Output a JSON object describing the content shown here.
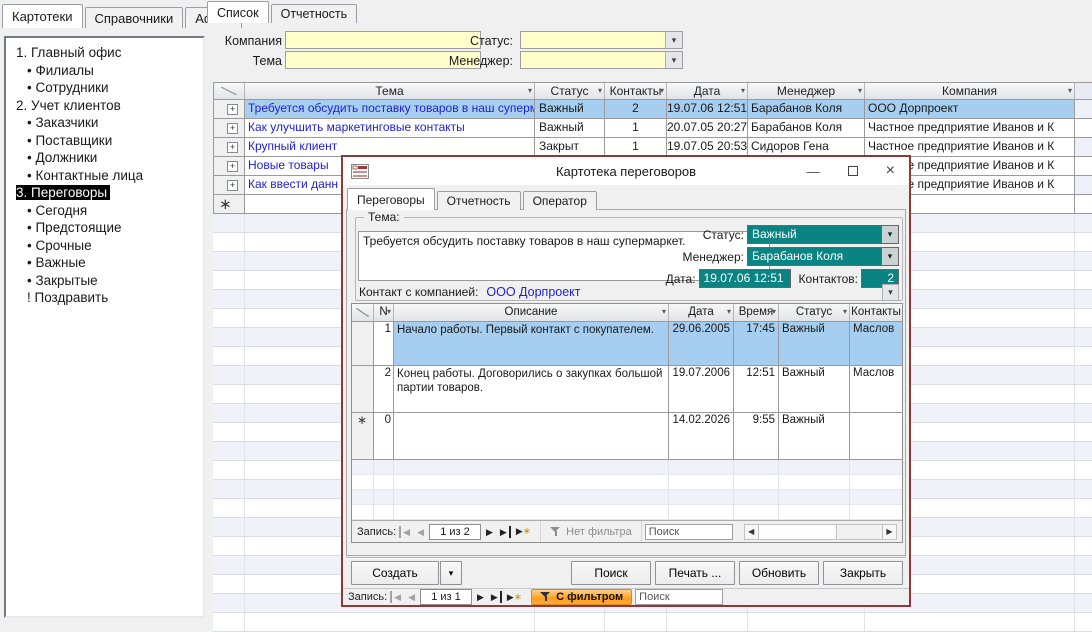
{
  "app": {
    "window_tabs": [
      {
        "label": "Картотеки"
      },
      {
        "label": "Справочники"
      },
      {
        "label": "Admin"
      }
    ],
    "sidebar": {
      "items": [
        {
          "label": "1. Главный офис"
        },
        {
          "label": "• Филиалы"
        },
        {
          "label": "• Сотрудники"
        },
        {
          "label": "2. Учет клиентов"
        },
        {
          "label": "• Заказчики"
        },
        {
          "label": "• Поставщики"
        },
        {
          "label": "• Должники"
        },
        {
          "label": "• Контактные лица"
        },
        {
          "label": "3. Переговоры",
          "selected": true
        },
        {
          "label": "• Сегодня"
        },
        {
          "label": "• Предстоящие"
        },
        {
          "label": "• Срочные"
        },
        {
          "label": "• Важные"
        },
        {
          "label": "• Закрытые"
        },
        {
          "label": "! Поздравить"
        }
      ]
    }
  },
  "main": {
    "tabs": [
      {
        "label": "Список"
      },
      {
        "label": "Отчетность"
      }
    ],
    "filters": {
      "company_label": "Компания",
      "theme_label": "Тема",
      "status_label": "Статус:",
      "manager_label": "Менеджер:",
      "company_value": "",
      "theme_value": "",
      "status_value": "",
      "manager_value": ""
    },
    "table": {
      "columns": [
        "Тема",
        "Статус",
        "Контакты",
        "Дата",
        "Менеджер",
        "Компания"
      ],
      "rows": [
        {
          "theme": "Требуется обсудить поставку товаров в наш супермаркет.",
          "status": "Важный",
          "contacts": "2",
          "date": "19.07.06 12:51",
          "manager": "Барабанов Коля",
          "company": "ООО Дорпроект"
        },
        {
          "theme": "Как улучшить маркетинговые контакты",
          "status": "Важный",
          "contacts": "1",
          "date": "20.07.05 20:27",
          "manager": "Барабанов Коля",
          "company": "Частное предприятие Иванов и К"
        },
        {
          "theme": "Крупный клиент",
          "status": "Закрыт",
          "contacts": "1",
          "date": "19.07.05 20:53",
          "manager": "Сидоров Гена",
          "company": "Частное предприятие Иванов и К"
        },
        {
          "theme": "Новые товары",
          "status": "",
          "contacts": "",
          "date": "",
          "manager": "",
          "company": "Частное предприятие Иванов и К"
        },
        {
          "theme": "Как ввести данн",
          "status": "",
          "contacts": "",
          "date": "",
          "manager": "",
          "company": "Частное предприятие Иванов и К"
        }
      ]
    }
  },
  "dialog": {
    "title": "Картотека переговоров",
    "window_icons": {
      "minimize": "—",
      "maximize": "maximize-box",
      "close": "×"
    },
    "tabs": [
      {
        "label": "Переговоры"
      },
      {
        "label": "Отчетность"
      },
      {
        "label": "Оператор"
      }
    ],
    "theme_group_label": "Тема:",
    "theme_text": "Требуется обсудить поставку товаров в наш супермаркет.",
    "status_label": "Статус:",
    "status": "Важный",
    "manager_label": "Менеджер:",
    "manager": "Барабанов Коля",
    "date_label": "Дата:",
    "date": "19.07.06 12:51",
    "contacts_label": "Контактов:",
    "contacts": "2",
    "contact_company_label": "Контакт с компанией:",
    "contact_company": "ООО Дорпроект",
    "subform": {
      "columns": [
        "N",
        "Описание",
        "Дата",
        "Время",
        "Статус",
        "Контакты"
      ],
      "rows": [
        {
          "n": "1",
          "desc": "Начало работы. Первый контакт с покупателем.",
          "date": "29.06.2005",
          "time": "17:45",
          "status": "Важный",
          "contact": "Маслов"
        },
        {
          "n": "2",
          "desc": "Конец работы. Договорились о закупках большой партии товаров.",
          "date": "19.07.2006",
          "time": "12:51",
          "status": "Важный",
          "contact": "Маслов"
        }
      ],
      "new_row": {
        "n": "0",
        "date": "14.02.2026",
        "time": "9:55",
        "status": "Важный"
      },
      "nav": {
        "record_label": "Запись:",
        "position": "1 из 2",
        "filter_label": "Нет фильтра",
        "search_placeholder": "Поиск"
      }
    },
    "buttons": {
      "create": "Создать",
      "search": "Поиск",
      "print": "Печать ...",
      "refresh": "Обновить",
      "close": "Закрыть"
    },
    "nav": {
      "record_label": "Запись:",
      "position": "1 из 1",
      "filter_label": "С фильтром",
      "search_placeholder": "Поиск"
    }
  },
  "colors": {
    "accent_teal": "#0a8482",
    "selection_blue": "#a6cef0",
    "filter_orange": "#ff9e1f",
    "input_yellow": "#ffffcb",
    "dialog_border": "#8b3a3a",
    "link_blue": "#2222cc"
  }
}
